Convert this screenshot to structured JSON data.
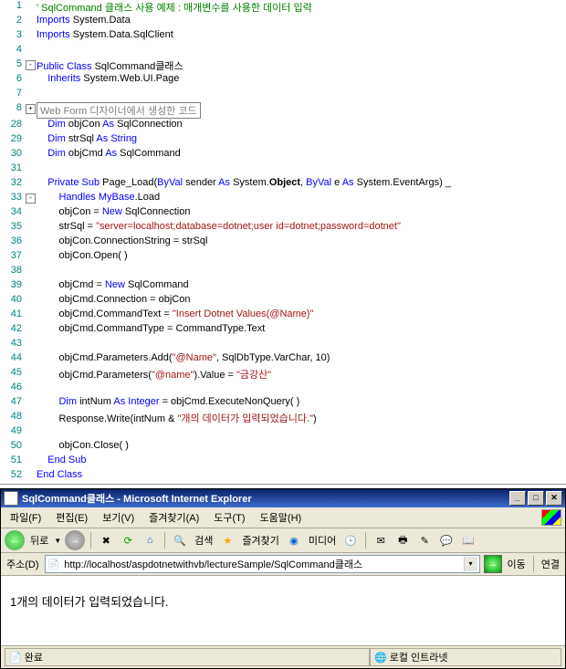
{
  "code": {
    "l1": "' SqlCommand 클래스 사용 예제 : 매개변수를 사용한 데이터 입력",
    "l2a": "Imports",
    "l2b": " System.Data",
    "l3a": "Imports",
    "l3b": " System.Data.SqlClient",
    "l5a": "Public Class",
    "l5b": " SqlCommand클래스",
    "l6a": "Inherits",
    "l6b": " System.Web.UI.Page",
    "l8": "Web Form 디자이너에서 생성한 코드",
    "l28a": "Dim",
    "l28b": " objCon ",
    "l28c": "As",
    "l28d": " SqlConnection",
    "l29a": "Dim",
    "l29b": " strSql ",
    "l29c": "As String",
    "l30a": "Dim",
    "l30b": " objCmd ",
    "l30c": "As",
    "l30d": " SqlCommand",
    "l32a": "Private Sub",
    "l32b": " Page_Load(",
    "l32c": "ByVal",
    "l32d": " sender ",
    "l32e": "As",
    "l32f": " System.",
    "l32g": "Object",
    "l32h": ", ",
    "l32i": "ByVal",
    "l32j": " e ",
    "l32k": "As",
    "l32l": " System.EventArgs) _",
    "l33a": "Handles",
    "l33b": " MyBase",
    "l33c": ".Load",
    "l34a": "objCon = ",
    "l34b": "New",
    "l34c": " SqlConnection",
    "l35a": "strSql = ",
    "l35b": "\"server=localhost;database=dotnet;user id=dotnet;password=dotnet\"",
    "l36": "objCon.ConnectionString = strSql",
    "l37": "objCon.Open( )",
    "l39a": "objCmd = ",
    "l39b": "New",
    "l39c": " SqlCommand",
    "l40": "objCmd.Connection = objCon",
    "l41a": "objCmd.CommandText = ",
    "l41b": "\"Insert Dotnet Values(@Name)\"",
    "l42": "objCmd.CommandType = CommandType.Text",
    "l44a": "objCmd.Parameters.Add(",
    "l44b": "\"@Name\"",
    "l44c": ", SqlDbType.VarChar, 10)",
    "l45a": "objCmd.Parameters(",
    "l45b": "\"@name\"",
    "l45c": ").Value = ",
    "l45d": "\"금강산\"",
    "l47a": "Dim",
    "l47b": " intNum ",
    "l47c": "As Integer",
    "l47d": " = objCmd.ExecuteNonQuery( )",
    "l48a": "Response.Write(intNum & ",
    "l48b": "\"개의 데이터가 입력되었습니다.\"",
    "l48c": ")",
    "l50": "objCon.Close( )",
    "l51": "End Sub",
    "l52": "End Class"
  },
  "line_numbers": [
    "1",
    "2",
    "3",
    "4",
    "5",
    "6",
    "7",
    "8",
    "28",
    "29",
    "30",
    "31",
    "32",
    "33",
    "34",
    "35",
    "36",
    "37",
    "38",
    "39",
    "40",
    "41",
    "42",
    "43",
    "44",
    "45",
    "46",
    "47",
    "48",
    "49",
    "50",
    "51",
    "52"
  ],
  "ie": {
    "title": "SqlCommand클래스 - Microsoft Internet Explorer",
    "menu": {
      "file": "파일(F)",
      "edit": "편집(E)",
      "view": "보기(V)",
      "fav": "즐겨찾기(A)",
      "tools": "도구(T)",
      "help": "도움말(H)"
    },
    "toolbar": {
      "back": "뒤로",
      "search": "검색",
      "fav": "즐겨찾기",
      "media": "미디어"
    },
    "addr": {
      "label": "주소(D)",
      "url": "http://localhost/aspdotnetwithvb/lectureSample/SqlCommand클래스",
      "go": "이동",
      "link": "연결"
    },
    "content": "1개의 데이터가 입력되었습니다.",
    "status": {
      "done": "완료",
      "zone": "로컬 인트라넷"
    }
  }
}
